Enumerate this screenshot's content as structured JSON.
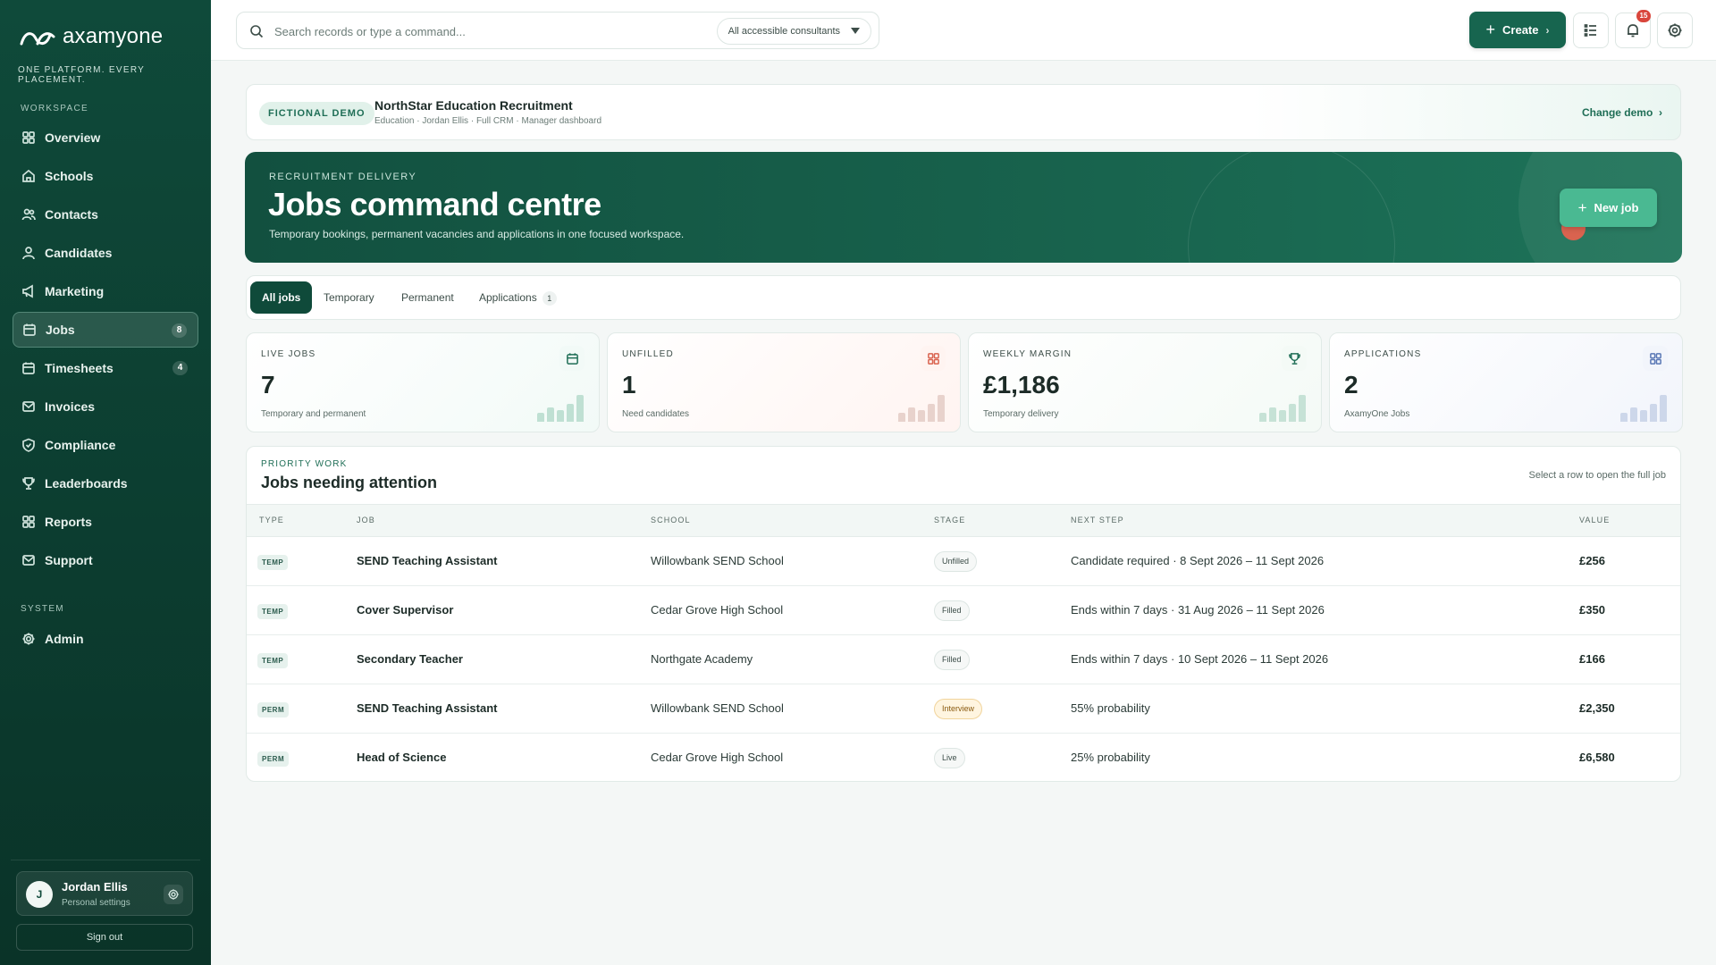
{
  "sidebar": {
    "brand": "axamyone",
    "tagline": "ONE PLATFORM. EVERY PLACEMENT.",
    "workspace_label": "WORKSPACE",
    "system_label": "SYSTEM",
    "items": [
      {
        "label": "Overview",
        "icon": "grid-icon"
      },
      {
        "label": "Schools",
        "icon": "home-icon"
      },
      {
        "label": "Contacts",
        "icon": "users-icon"
      },
      {
        "label": "Candidates",
        "icon": "person-icon"
      },
      {
        "label": "Marketing",
        "icon": "megaphone-icon"
      },
      {
        "label": "Jobs",
        "icon": "calendar-icon",
        "badge": "8",
        "active": true
      },
      {
        "label": "Timesheets",
        "icon": "calendar-icon",
        "badge": "4"
      },
      {
        "label": "Invoices",
        "icon": "mail-icon"
      },
      {
        "label": "Compliance",
        "icon": "shield-icon"
      },
      {
        "label": "Leaderboards",
        "icon": "trophy-icon"
      },
      {
        "label": "Reports",
        "icon": "grid-icon"
      },
      {
        "label": "Support",
        "icon": "mail-icon"
      }
    ],
    "system_items": [
      {
        "label": "Admin",
        "icon": "gear-icon"
      }
    ],
    "user": {
      "initial": "J",
      "name": "Jordan Ellis",
      "sub": "Personal settings"
    },
    "signout": "Sign out"
  },
  "topbar": {
    "search_placeholder": "Search records or type a command...",
    "consultants": "All accessible consultants",
    "create": "Create",
    "notifications_count": "15"
  },
  "demo": {
    "tag": "FICTIONAL DEMO",
    "title": "NorthStar Education Recruitment",
    "sub": "Education · Jordan Ellis · Full CRM · Manager dashboard",
    "change": "Change demo"
  },
  "hero": {
    "eyebrow": "RECRUITMENT DELIVERY",
    "title": "Jobs command centre",
    "sub": "Temporary bookings, permanent vacancies and applications in one focused workspace.",
    "new_job": "New job"
  },
  "tabs": [
    {
      "label": "All jobs",
      "active": true
    },
    {
      "label": "Temporary"
    },
    {
      "label": "Permanent"
    },
    {
      "label": "Applications",
      "badge": "1"
    }
  ],
  "stats": [
    {
      "label": "LIVE JOBS",
      "value": "7",
      "sub": "Temporary and permanent",
      "icon": "calendar-icon",
      "accent": "#1f6e56",
      "bg": "#f2faf7",
      "bar": "#bfe0d3"
    },
    {
      "label": "UNFILLED",
      "value": "1",
      "sub": "Need candidates",
      "icon": "grid-icon",
      "accent": "#d9634f",
      "bg": "#fff4f1",
      "bar": "#e8d2cc"
    },
    {
      "label": "WEEKLY MARGIN",
      "value": "£1,186",
      "sub": "Temporary delivery",
      "icon": "trophy-icon",
      "accent": "#1f6e56",
      "bg": "#f4faf6",
      "bar": "#c6e2d6"
    },
    {
      "label": "APPLICATIONS",
      "value": "2",
      "sub": "AxamyOne Jobs",
      "icon": "grid-icon",
      "accent": "#5a78b5",
      "bg": "#f2f5fb",
      "bar": "#cdd7ea"
    }
  ],
  "attention": {
    "eyebrow": "PRIORITY WORK",
    "title": "Jobs needing attention",
    "hint": "Select a row to open the full job",
    "columns": [
      "TYPE",
      "JOB",
      "SCHOOL",
      "STAGE",
      "NEXT STEP",
      "VALUE"
    ],
    "rows": [
      {
        "type": "TEMP",
        "job": "SEND Teaching Assistant",
        "school": "Willowbank SEND School",
        "stage": "Unfilled",
        "next": "Candidate required · 8 Sept 2026 – 11 Sept 2026",
        "value": "£256"
      },
      {
        "type": "TEMP",
        "job": "Cover Supervisor",
        "school": "Cedar Grove High School",
        "stage": "Filled",
        "next": "Ends within 7 days · 31 Aug 2026 – 11 Sept 2026",
        "value": "£350"
      },
      {
        "type": "TEMP",
        "job": "Secondary Teacher",
        "school": "Northgate Academy",
        "stage": "Filled",
        "next": "Ends within 7 days · 10 Sept 2026 – 11 Sept 2026",
        "value": "£166"
      },
      {
        "type": "PERM",
        "job": "SEND Teaching Assistant",
        "school": "Willowbank SEND School",
        "stage": "Interview",
        "next": "55% probability",
        "value": "£2,350"
      },
      {
        "type": "PERM",
        "job": "Head of Science",
        "school": "Cedar Grove High School",
        "stage": "Live",
        "next": "25% probability",
        "value": "£6,580"
      }
    ]
  },
  "colors": {
    "brand": "#0f4a3a",
    "accent": "#17654f",
    "new_job": "#4ab992",
    "alert": "#d9463c"
  }
}
